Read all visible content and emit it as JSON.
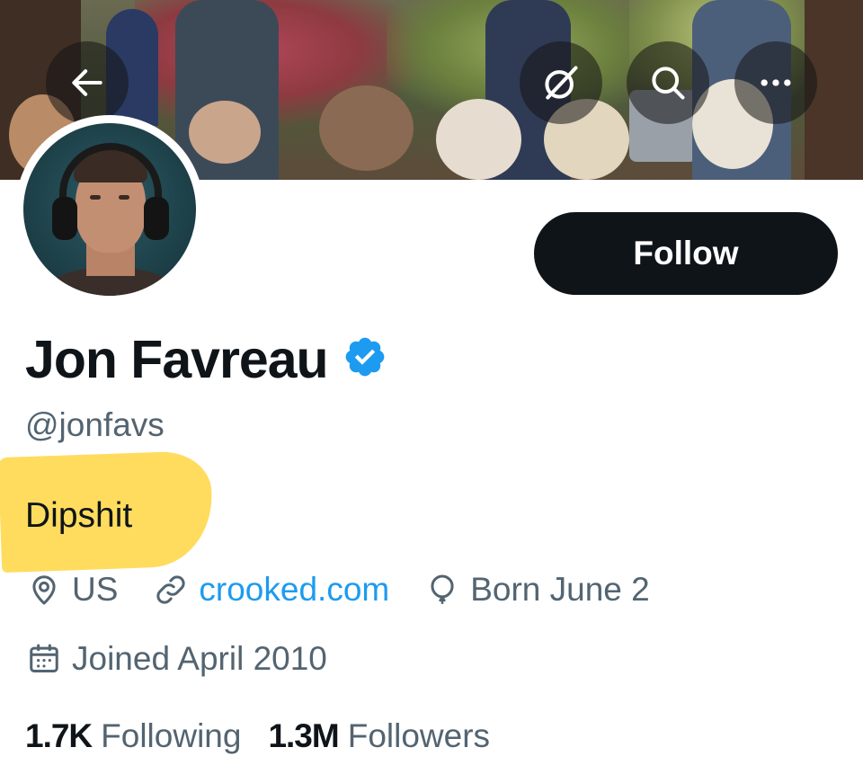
{
  "profile": {
    "display_name": "Jon Favreau",
    "handle": "@jonfavs",
    "bio": "Dipshit",
    "location": "US",
    "website": "crooked.com",
    "birthday": "Born June 2",
    "joined": "Joined April 2010",
    "verified": true
  },
  "actions": {
    "follow_label": "Follow"
  },
  "stats": {
    "following_count": "1.7K",
    "following_label": "Following",
    "followers_count": "1.3M",
    "followers_label": "Followers"
  },
  "colors": {
    "accent": "#1d9bf0",
    "text_primary": "#0f1419",
    "text_secondary": "#536471",
    "follow_button_bg": "#0f1419",
    "highlight": "#ffd84d"
  },
  "icons": {
    "back": "arrow-left-icon",
    "grok": "grok-icon",
    "search": "search-icon",
    "more": "more-icon",
    "verified": "verified-badge-icon",
    "location": "location-pin-icon",
    "link": "link-icon",
    "birthday": "balloon-icon",
    "calendar": "calendar-icon"
  }
}
